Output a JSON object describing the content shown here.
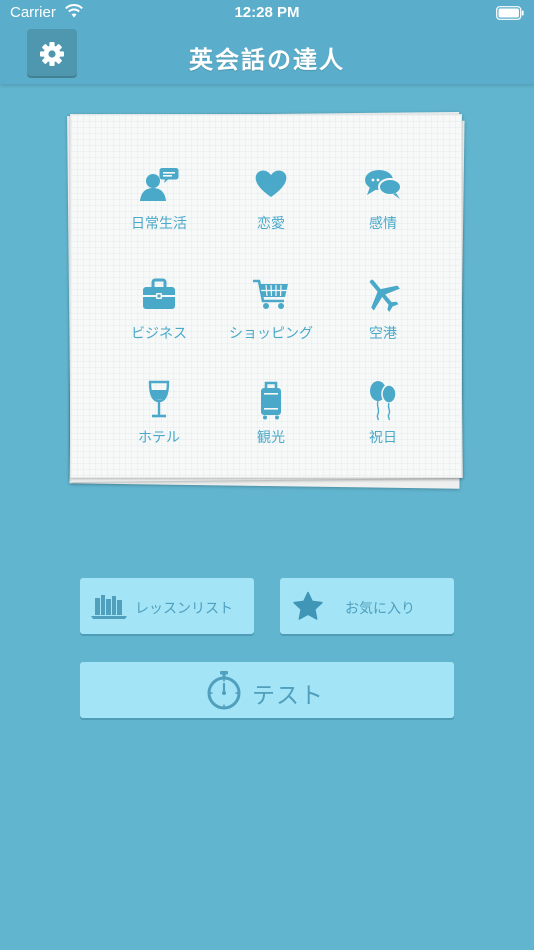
{
  "status_bar": {
    "carrier": "Carrier",
    "time": "12:28 PM",
    "wifi_icon": "wifi-icon",
    "battery_icon": "battery-icon"
  },
  "nav": {
    "title": "英会話の達人",
    "settings_icon": "gear-icon"
  },
  "categories": [
    {
      "label": "日常生活",
      "icon": "person-speech-icon"
    },
    {
      "label": "恋愛",
      "icon": "heart-icon"
    },
    {
      "label": "感情",
      "icon": "speech-bubbles-icon"
    },
    {
      "label": "ビジネス",
      "icon": "briefcase-icon"
    },
    {
      "label": "ショッピング",
      "icon": "shopping-cart-icon"
    },
    {
      "label": "空港",
      "icon": "airplane-icon"
    },
    {
      "label": "ホテル",
      "icon": "wine-glass-icon"
    },
    {
      "label": "観光",
      "icon": "suitcase-icon"
    },
    {
      "label": "祝日",
      "icon": "balloons-icon"
    }
  ],
  "buttons": {
    "lessons": {
      "label": "レッスンリスト",
      "icon": "books-icon"
    },
    "favorites": {
      "label": "お気に入り",
      "icon": "star-icon"
    },
    "test": {
      "label": "テスト",
      "icon": "stopwatch-icon"
    }
  },
  "colors": {
    "background": "#61b5cf",
    "nav_bar": "#5aaecb",
    "accent": "#4aa9c9",
    "button": "#a4e4f7"
  }
}
